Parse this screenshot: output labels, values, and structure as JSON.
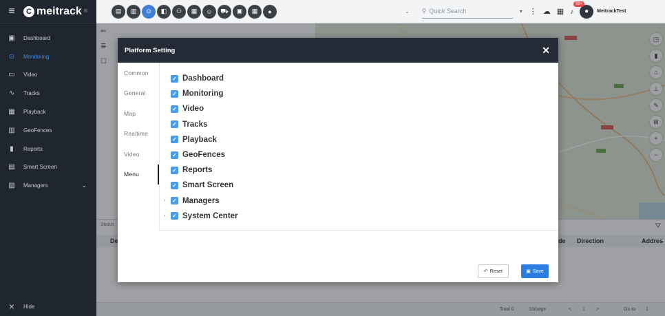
{
  "brand": {
    "name": "meitrack",
    "mark": "C",
    "sup": "®"
  },
  "sidebar": {
    "items": [
      {
        "label": "Dashboard",
        "icon": "▣",
        "active": false
      },
      {
        "label": "Monitoring",
        "icon": "⊙",
        "active": true
      },
      {
        "label": "Video",
        "icon": "▭",
        "active": false
      },
      {
        "label": "Tracks",
        "icon": "∿",
        "active": false
      },
      {
        "label": "Playback",
        "icon": "▦",
        "active": false
      },
      {
        "label": "GeoFences",
        "icon": "▥",
        "active": false
      },
      {
        "label": "Reports",
        "icon": "▮",
        "active": false
      },
      {
        "label": "Smart Screen",
        "icon": "▤",
        "active": false
      },
      {
        "label": "Managers",
        "icon": "▧",
        "active": false,
        "caret": "⌄"
      }
    ],
    "hide_label": "Hide",
    "hide_icon": "×",
    "menu_icon": "≡"
  },
  "topbar": {
    "tools": [
      "▤",
      "▥",
      "⊙",
      "◧",
      "⚇",
      "▦",
      "☺",
      "⛟",
      "▣",
      "▦",
      "●"
    ],
    "dropdown_caret": "⌄",
    "search_placeholder": "Quick Search",
    "search_caret": "▾",
    "kebab": "⋮",
    "cloud": "☁",
    "grid": "▦",
    "bell": "🔔",
    "badge": "99+",
    "username": "MeitrackTest"
  },
  "map": {
    "tools": [
      "◳",
      "▮",
      "⌂",
      "⊥",
      "✎",
      "⊞",
      "+",
      "−"
    ]
  },
  "panel": {
    "back": "⇐",
    "list": "≣",
    "checkbox": "☐"
  },
  "bottom": {
    "status_tab": "Status",
    "columns": {
      "de": "De",
      "de2": "de",
      "direction": "Direction",
      "address": "Addres"
    },
    "filter_icon": "⛛",
    "pager": {
      "total": "Total 0",
      "per_page": "10/page",
      "prev": "<",
      "page": "1",
      "next": ">",
      "goto": "Go to",
      "goto_value": "1"
    }
  },
  "modal": {
    "title": "Platform Setting",
    "close": "✕",
    "tabs": [
      "Common",
      "General",
      "Map",
      "Realtime",
      "Video",
      "Menu"
    ],
    "active_tab": "Menu",
    "permissions": [
      {
        "label": "Dashboard",
        "checked": true,
        "expandable": false
      },
      {
        "label": "Monitoring",
        "checked": true,
        "expandable": false
      },
      {
        "label": "Video",
        "checked": true,
        "expandable": false
      },
      {
        "label": "Tracks",
        "checked": true,
        "expandable": false
      },
      {
        "label": "Playback",
        "checked": true,
        "expandable": false
      },
      {
        "label": "GeoFences",
        "checked": true,
        "expandable": false
      },
      {
        "label": "Reports",
        "checked": true,
        "expandable": false
      },
      {
        "label": "Smart Screen",
        "checked": true,
        "expandable": false
      },
      {
        "label": "Managers",
        "checked": true,
        "expandable": true
      },
      {
        "label": "System Center",
        "checked": true,
        "expandable": true
      }
    ],
    "reset_label": "Reset",
    "reset_icon": "↶",
    "save_label": "Save",
    "save_icon": "▣"
  }
}
